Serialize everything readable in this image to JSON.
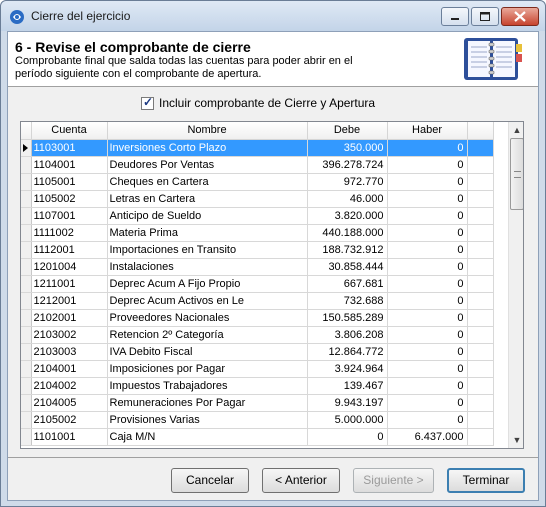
{
  "window": {
    "title": "Cierre del ejercicio"
  },
  "header": {
    "step_title": "6 - Revise el comprobante de cierre",
    "step_desc": "Comprobante final que salda todas las cuentas para poder abrir en el período siguiente con el comprobante de apertura."
  },
  "checkbox": {
    "label": "Incluir comprobante de Cierre y Apertura",
    "checked": true
  },
  "grid": {
    "columns": [
      "Cuenta",
      "Nombre",
      "Debe",
      "Haber"
    ],
    "rows": [
      [
        "1103001",
        "Inversiones Corto Plazo",
        "350.000",
        "0"
      ],
      [
        "1104001",
        "Deudores Por Ventas",
        "396.278.724",
        "0"
      ],
      [
        "1105001",
        "Cheques en Cartera",
        "972.770",
        "0"
      ],
      [
        "1105002",
        "Letras en Cartera",
        "46.000",
        "0"
      ],
      [
        "1107001",
        "Anticipo de Sueldo",
        "3.820.000",
        "0"
      ],
      [
        "1111002",
        "Materia Prima",
        "440.188.000",
        "0"
      ],
      [
        "1112001",
        "Importaciones en Transito",
        "188.732.912",
        "0"
      ],
      [
        "1201004",
        "Instalaciones",
        "30.858.444",
        "0"
      ],
      [
        "1211001",
        "Deprec Acum A Fijo Propio",
        "667.681",
        "0"
      ],
      [
        "1212001",
        "Deprec Acum Activos en Le",
        "732.688",
        "0"
      ],
      [
        "2102001",
        "Proveedores Nacionales",
        "150.585.289",
        "0"
      ],
      [
        "2103002",
        "Retencion 2º Categoría",
        "3.806.208",
        "0"
      ],
      [
        "2103003",
        "IVA Debito Fiscal",
        "12.864.772",
        "0"
      ],
      [
        "2104001",
        "Imposiciones por Pagar",
        "3.924.964",
        "0"
      ],
      [
        "2104002",
        "Impuestos Trabajadores",
        "139.467",
        "0"
      ],
      [
        "2104005",
        "Remuneraciones Por Pagar",
        "9.943.197",
        "0"
      ],
      [
        "2105002",
        "Provisiones Varias",
        "5.000.000",
        "0"
      ],
      [
        "1101001",
        "Caja M/N",
        "0",
        "6.437.000"
      ]
    ]
  },
  "buttons": {
    "cancel": "Cancelar",
    "back": "< Anterior",
    "next": "Siguiente >",
    "finish": "Terminar"
  },
  "colors": {
    "selection": "#3399ff",
    "window_frame": "#cfdbe9"
  }
}
